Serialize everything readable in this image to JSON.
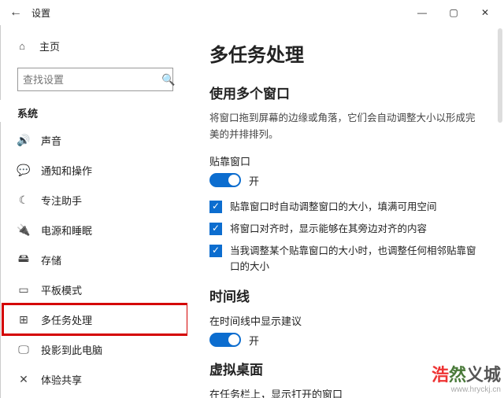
{
  "window": {
    "title": "设置",
    "min": "—",
    "max": "▢",
    "close": "✕"
  },
  "sidebar": {
    "home_label": "主页",
    "search_placeholder": "查找设置",
    "section": "系统",
    "items": [
      {
        "icon": "🔊",
        "label": "声音"
      },
      {
        "icon": "💬",
        "label": "通知和操作"
      },
      {
        "icon": "☾",
        "label": "专注助手"
      },
      {
        "icon": "🔌",
        "label": "电源和睡眠"
      },
      {
        "icon": "🖴",
        "label": "存储"
      },
      {
        "icon": "▭",
        "label": "平板模式"
      },
      {
        "icon": "⊞",
        "label": "多任务处理",
        "selected": true
      },
      {
        "icon": "🖵",
        "label": "投影到此电脑"
      },
      {
        "icon": "✕",
        "label": "体验共享"
      }
    ]
  },
  "content": {
    "h1": "多任务处理",
    "sec1_title": "使用多个窗口",
    "sec1_para": "将窗口拖到屏幕的边缘或角落，它们会自动调整大小以形成完美的并排排列。",
    "snap_label": "贴靠窗口",
    "snap_state": "开",
    "checks": [
      "贴靠窗口时自动调整窗口的大小，填满可用空间",
      "将窗口对齐时，显示能够在其旁边对齐的内容",
      "当我调整某个贴靠窗口的大小时，也调整任何相邻贴靠窗口的大小"
    ],
    "sec2_title": "时间线",
    "timeline_label": "在时间线中显示建议",
    "timeline_state": "开",
    "sec3_title": "虚拟桌面",
    "vd_label": "在任务栏上，显示打开的窗口"
  },
  "watermark": {
    "brand_r": "浩",
    "brand_g": "然",
    "brand_tail": "义城",
    "url": "www.hryckj.cn"
  }
}
